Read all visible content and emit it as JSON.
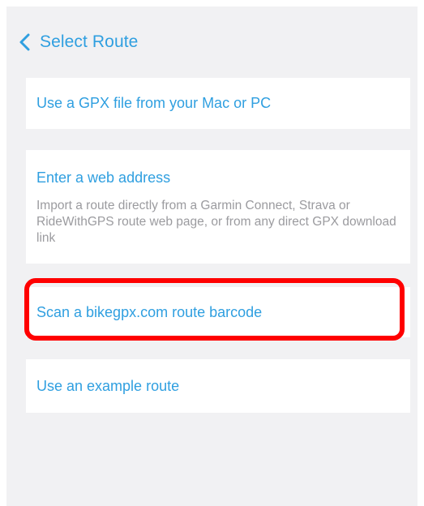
{
  "nav": {
    "back_icon": "chevron-left-icon",
    "title": "Select Route"
  },
  "options": {
    "gpx_file": {
      "label": "Use a GPX file from your Mac or PC"
    },
    "web_address": {
      "label": "Enter a web address",
      "description": "Import a route directly from a Garmin Connect, Strava or RideWithGPS route web page, or from any direct GPX download link"
    },
    "scan_barcode": {
      "label": "Scan a bikegpx.com route barcode",
      "highlighted": true
    },
    "example_route": {
      "label": "Use an example route"
    }
  },
  "colors": {
    "accent": "#2f9fe0",
    "background": "#f1f1f3",
    "card": "#ffffff",
    "secondary_text": "#9b9b9f",
    "highlight": "#ff0000"
  }
}
